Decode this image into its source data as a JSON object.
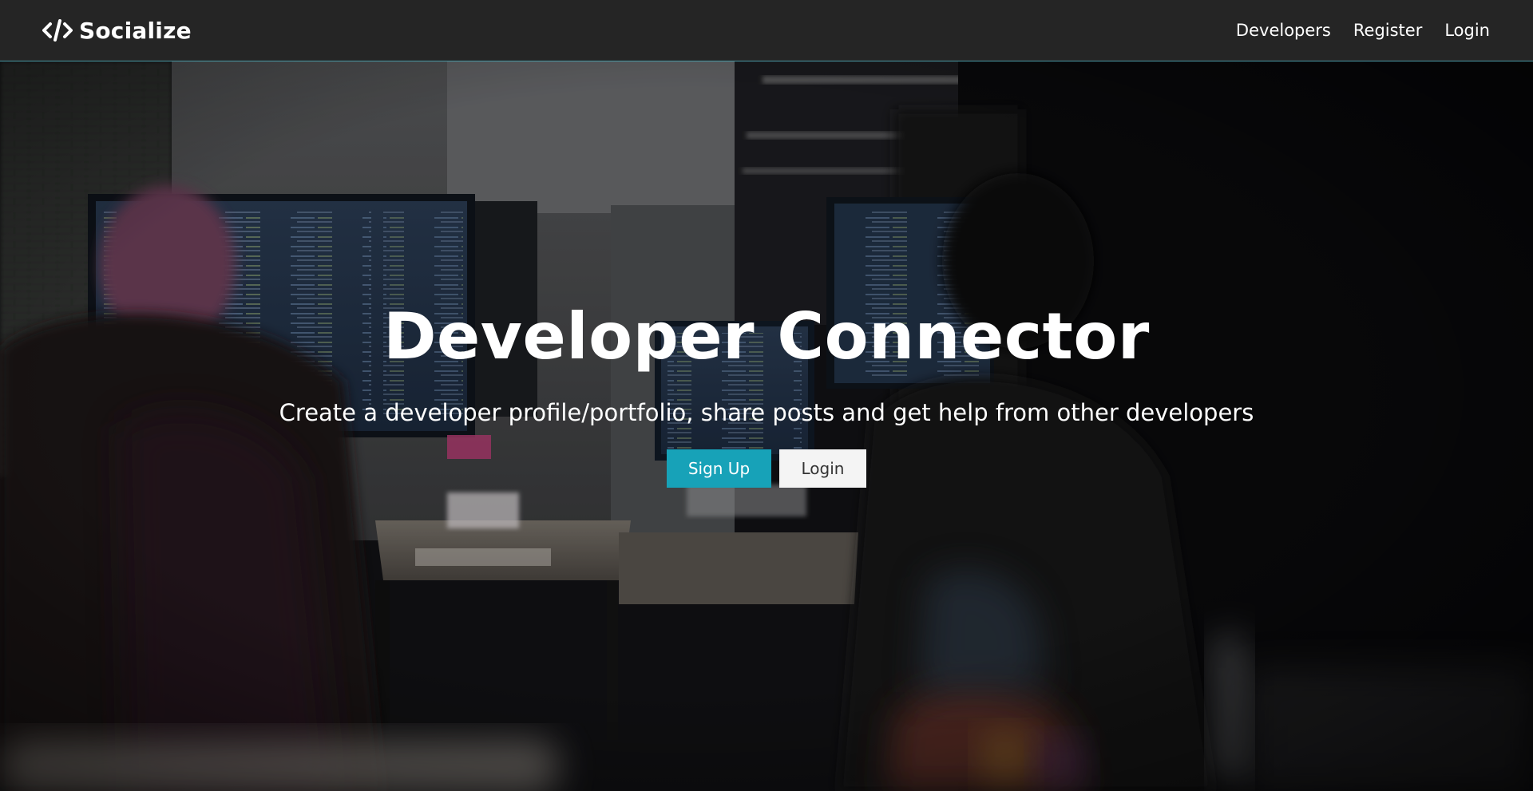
{
  "brand": {
    "name": "Socialize",
    "icon": "code-icon"
  },
  "nav": {
    "links": [
      {
        "label": "Developers"
      },
      {
        "label": "Register"
      },
      {
        "label": "Login"
      }
    ]
  },
  "landing": {
    "title": "Developer Connector",
    "lead": "Create a developer profile/portfolio, share posts and get help from other developers",
    "signup_label": "Sign Up",
    "login_label": "Login"
  },
  "colors": {
    "navbar_bg": "#252525",
    "primary": "#17a2b8",
    "light": "#f4f4f4"
  }
}
